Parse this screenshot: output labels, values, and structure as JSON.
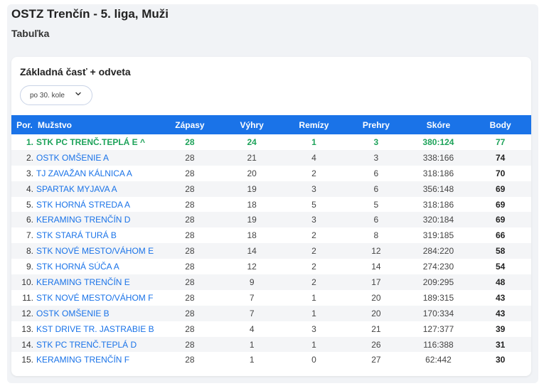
{
  "header": {
    "title": "OSTZ Trenčín - 5. liga, Muži",
    "subtitle": "Tabuľka"
  },
  "section": {
    "title": "Základná časť + odveta",
    "round_select": "po 30. kole"
  },
  "table": {
    "columns": [
      "Por.",
      "Mužstvo",
      "Zápasy",
      "Výhry",
      "Remízy",
      "Prehry",
      "Skóre",
      "Body"
    ],
    "rows": [
      {
        "pos": "1.",
        "team": "STK PC TRENČ.TEPLÁ E ^",
        "played": "28",
        "wins": "24",
        "draws": "1",
        "losses": "3",
        "score": "380:124",
        "points": "77"
      },
      {
        "pos": "2.",
        "team": "OSTK OMŠENIE A",
        "played": "28",
        "wins": "21",
        "draws": "4",
        "losses": "3",
        "score": "338:166",
        "points": "74"
      },
      {
        "pos": "3.",
        "team": "TJ ZAVAŽAN KÁLNICA A",
        "played": "28",
        "wins": "20",
        "draws": "2",
        "losses": "6",
        "score": "318:186",
        "points": "70"
      },
      {
        "pos": "4.",
        "team": "SPARTAK MYJAVA A",
        "played": "28",
        "wins": "19",
        "draws": "3",
        "losses": "6",
        "score": "356:148",
        "points": "69"
      },
      {
        "pos": "5.",
        "team": "STK HORNÁ STREDA A",
        "played": "28",
        "wins": "18",
        "draws": "5",
        "losses": "5",
        "score": "318:186",
        "points": "69"
      },
      {
        "pos": "6.",
        "team": "KERAMING TRENČÍN D",
        "played": "28",
        "wins": "19",
        "draws": "3",
        "losses": "6",
        "score": "320:184",
        "points": "69"
      },
      {
        "pos": "7.",
        "team": "STK STARÁ TURÁ B",
        "played": "28",
        "wins": "18",
        "draws": "2",
        "losses": "8",
        "score": "319:185",
        "points": "66"
      },
      {
        "pos": "8.",
        "team": "STK NOVÉ MESTO/VÁHOM E",
        "played": "28",
        "wins": "14",
        "draws": "2",
        "losses": "12",
        "score": "284:220",
        "points": "58"
      },
      {
        "pos": "9.",
        "team": "STK HORNÁ SÚČA A",
        "played": "28",
        "wins": "12",
        "draws": "2",
        "losses": "14",
        "score": "274:230",
        "points": "54"
      },
      {
        "pos": "10.",
        "team": "KERAMING TRENČÍN E",
        "played": "28",
        "wins": "9",
        "draws": "2",
        "losses": "17",
        "score": "209:295",
        "points": "48"
      },
      {
        "pos": "11.",
        "team": "STK NOVÉ MESTO/VÁHOM F",
        "played": "28",
        "wins": "7",
        "draws": "1",
        "losses": "20",
        "score": "189:315",
        "points": "43"
      },
      {
        "pos": "12.",
        "team": "OSTK OMŠENIE B",
        "played": "28",
        "wins": "7",
        "draws": "1",
        "losses": "20",
        "score": "170:334",
        "points": "43"
      },
      {
        "pos": "13.",
        "team": "KST DRIVE TR. JASTRABIE B",
        "played": "28",
        "wins": "4",
        "draws": "3",
        "losses": "21",
        "score": "127:377",
        "points": "39"
      },
      {
        "pos": "14.",
        "team": "STK PC TRENČ.TEPLÁ D",
        "played": "28",
        "wins": "1",
        "draws": "1",
        "losses": "26",
        "score": "116:388",
        "points": "31"
      },
      {
        "pos": "15.",
        "team": "KERAMING TRENČÍN F",
        "played": "28",
        "wins": "1",
        "draws": "0",
        "losses": "27",
        "score": "62:442",
        "points": "30"
      }
    ]
  },
  "colors": {
    "header_bg": "#1a73e8",
    "team_link": "#1a73e8",
    "leader": "#1ea35a",
    "page_bg": "#f1f3f6"
  },
  "icons": {
    "round_select": "chevron-down-icon"
  }
}
